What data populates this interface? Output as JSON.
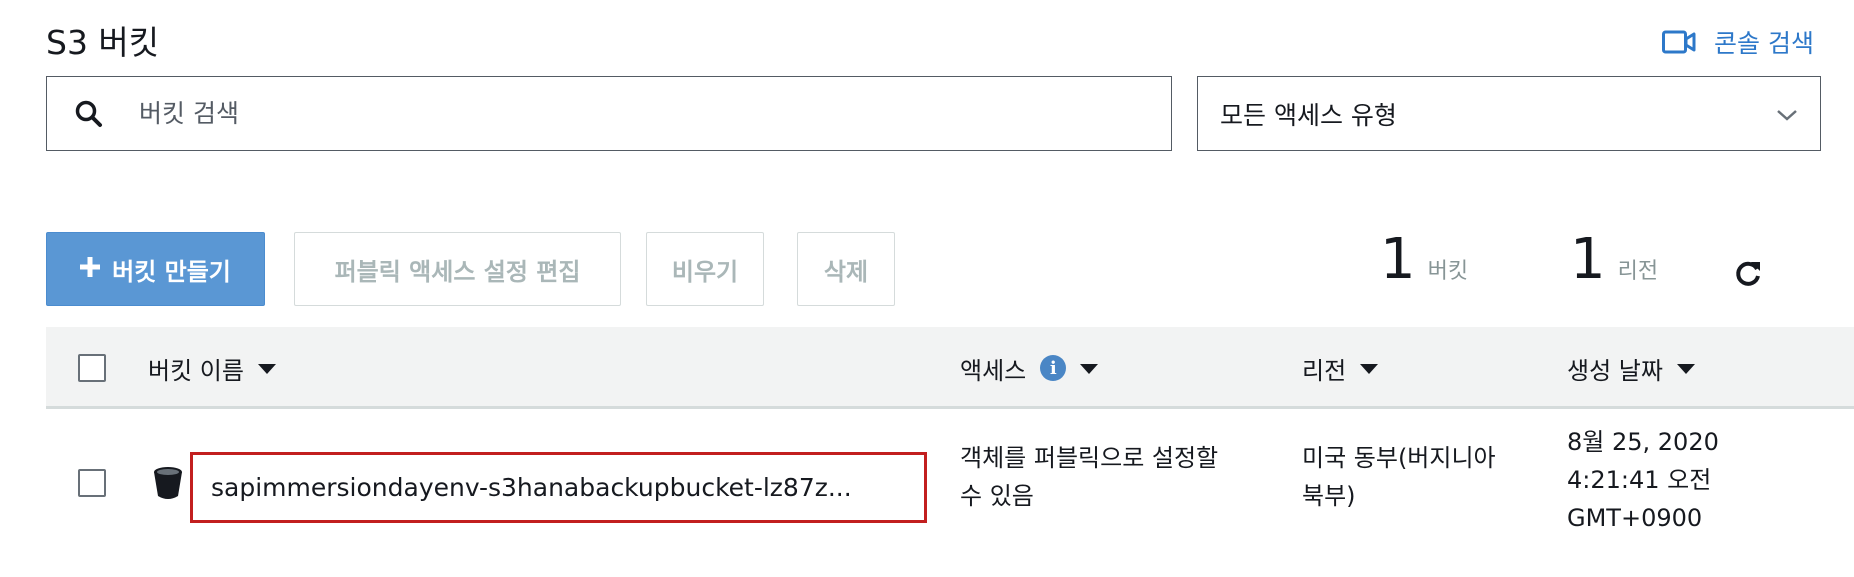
{
  "header": {
    "title": "S3 버킷",
    "console_search_label": "콘솔 검색"
  },
  "search": {
    "placeholder": "버킷 검색",
    "value": ""
  },
  "access_filter": {
    "selected": "모든 액세스 유형"
  },
  "toolbar": {
    "create_label": "버킷 만들기",
    "edit_public_access_label": "퍼블릭 액세스 설정 편집",
    "empty_label": "비우기",
    "delete_label": "삭제"
  },
  "summary": {
    "bucket_count": "1",
    "bucket_label": "버킷",
    "region_count": "1",
    "region_label": "리전"
  },
  "table": {
    "columns": {
      "name": "버킷 이름",
      "access": "액세스",
      "region": "리전",
      "created": "생성 날짜"
    },
    "rows": [
      {
        "name": "sapimmersiondayenv-s3hanabackupbucket-lz87z...",
        "access_line1": "객체를 퍼블릭으로 설정할",
        "access_line2": "수 있음",
        "region_line1": "미국 동부(버지니아",
        "region_line2": "북부)",
        "created_line1": "8월 25, 2020",
        "created_line2": "4:21:41 오전",
        "created_line3": "GMT+0900"
      }
    ]
  },
  "colors": {
    "primary": "#5a97d4",
    "link": "#2d78c9",
    "highlight": "#c21f1f"
  }
}
